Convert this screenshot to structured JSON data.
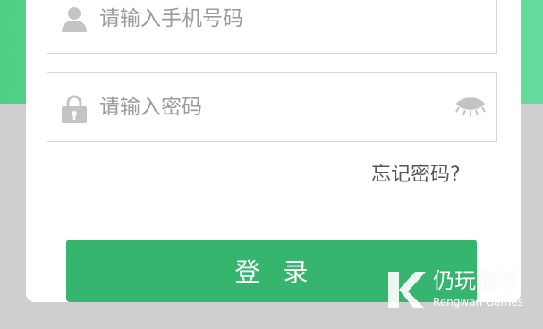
{
  "form": {
    "phone_placeholder": "请输入手机号码",
    "password_placeholder": "请输入密码",
    "forgot_label": "忘记密码?",
    "login_label": "登录"
  },
  "watermark": {
    "name": "仍玩游戏",
    "sub": "Rengwan Games"
  },
  "icons": {
    "phone_field": "user-icon",
    "password_field": "lock-icon",
    "toggle": "eye-closed-icon"
  },
  "colors": {
    "header_green": "#5ad98f",
    "button_green": "#36b56f",
    "background_gray": "#cfcfcf"
  }
}
